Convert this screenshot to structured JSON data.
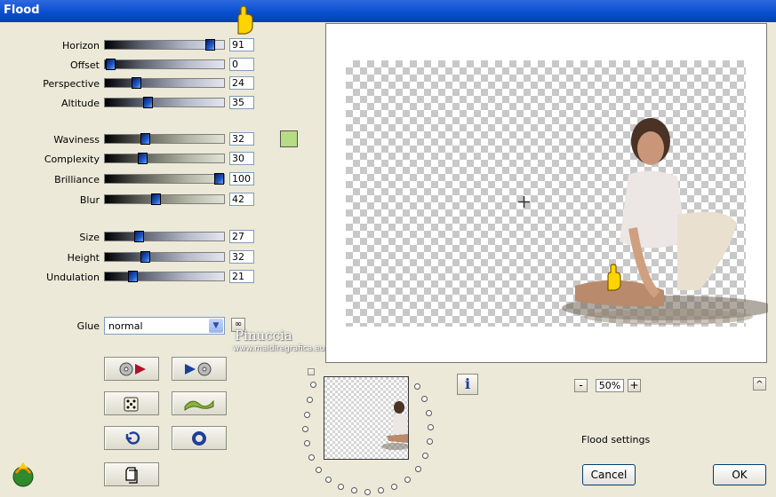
{
  "window": {
    "title": "Flood"
  },
  "sliders": [
    {
      "label": "Horizon",
      "value": "91"
    },
    {
      "label": "Offset",
      "value": "0"
    },
    {
      "label": "Perspective",
      "value": "24"
    },
    {
      "label": "Altitude",
      "value": "35"
    },
    {
      "label": "Waviness",
      "value": "32"
    },
    {
      "label": "Complexity",
      "value": "30"
    },
    {
      "label": "Brilliance",
      "value": "100"
    },
    {
      "label": "Blur",
      "value": "42"
    },
    {
      "label": "Size",
      "value": "27"
    },
    {
      "label": "Height",
      "value": "32"
    },
    {
      "label": "Undulation",
      "value": "21"
    }
  ],
  "color_swatch": "#b6dc84",
  "glue": {
    "label": "Glue",
    "value": "normal"
  },
  "watermark": {
    "line1": "Pinuccia",
    "line2": "www.maidiregrafica.eu"
  },
  "zoom": {
    "minus": "-",
    "value": "50%",
    "plus": "+"
  },
  "status_text": "Flood settings",
  "buttons": {
    "cancel": "Cancel",
    "ok": "OK",
    "info": "i",
    "scroll_up": "^",
    "link": "∞"
  },
  "icons": {
    "pointer": "pointing-hand-icon",
    "app_logo": "app-logo-icon"
  }
}
